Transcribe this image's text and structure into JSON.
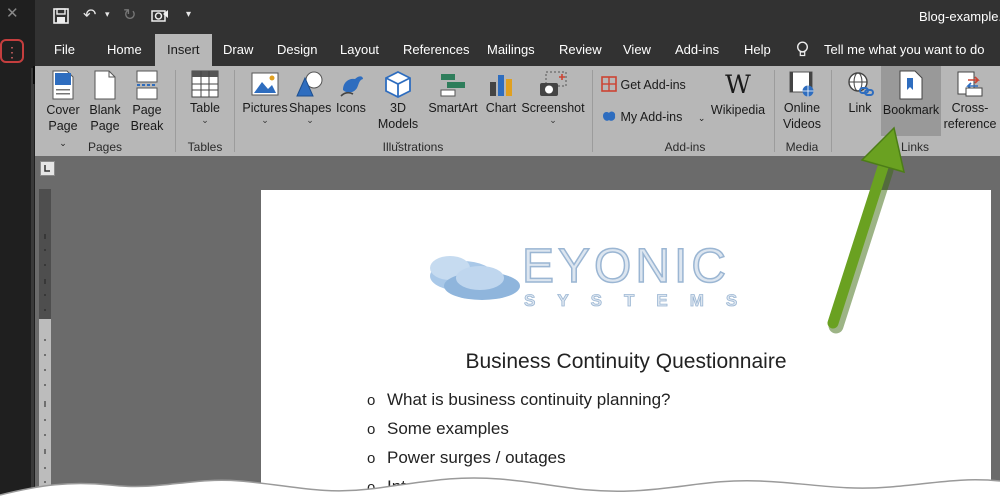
{
  "window": {
    "title": "Blog-example."
  },
  "tabs": [
    {
      "label": "File"
    },
    {
      "label": "Home"
    },
    {
      "label": "Insert"
    },
    {
      "label": "Draw"
    },
    {
      "label": "Design"
    },
    {
      "label": "Layout"
    },
    {
      "label": "References"
    },
    {
      "label": "Mailings"
    },
    {
      "label": "Review"
    },
    {
      "label": "View"
    },
    {
      "label": "Add-ins"
    },
    {
      "label": "Help"
    }
  ],
  "tellme": "Tell me what you want to do",
  "ribbon": {
    "pages": {
      "cover_l1": "Cover",
      "cover_l2": "Page",
      "blank_l1": "Blank",
      "blank_l2": "Page",
      "break_l1": "Page",
      "break_l2": "Break",
      "group": "Pages"
    },
    "tables": {
      "table": "Table",
      "group": "Tables"
    },
    "illustrations": {
      "pictures": "Pictures",
      "shapes": "Shapes",
      "icons": "Icons",
      "models_l1": "3D",
      "models_l2": "Models",
      "smartart": "SmartArt",
      "chart": "Chart",
      "screenshot": "Screenshot",
      "group": "Illustrations"
    },
    "addins": {
      "get": "Get Add-ins",
      "my": "My Add-ins",
      "wikipedia": "Wikipedia",
      "group": "Add-ins"
    },
    "media": {
      "online_l1": "Online",
      "online_l2": "Videos",
      "group": "Media"
    },
    "links": {
      "link": "Link",
      "bookmark": "Bookmark",
      "cross_l1": "Cross-",
      "cross_l2": "reference",
      "group": "Links"
    }
  },
  "document": {
    "logo": {
      "main": "EYONIC",
      "sub": "SYSTEMS"
    },
    "heading": "Business Continuity Questionnaire",
    "bullets": [
      "What is business continuity planning?",
      "Some examples",
      "Power surges / outages",
      "Internet"
    ]
  },
  "colors": {
    "accent_arrow": "#6aa121",
    "ribbon_bg": "#b7b7b7",
    "titlebar_bg": "#323232"
  }
}
